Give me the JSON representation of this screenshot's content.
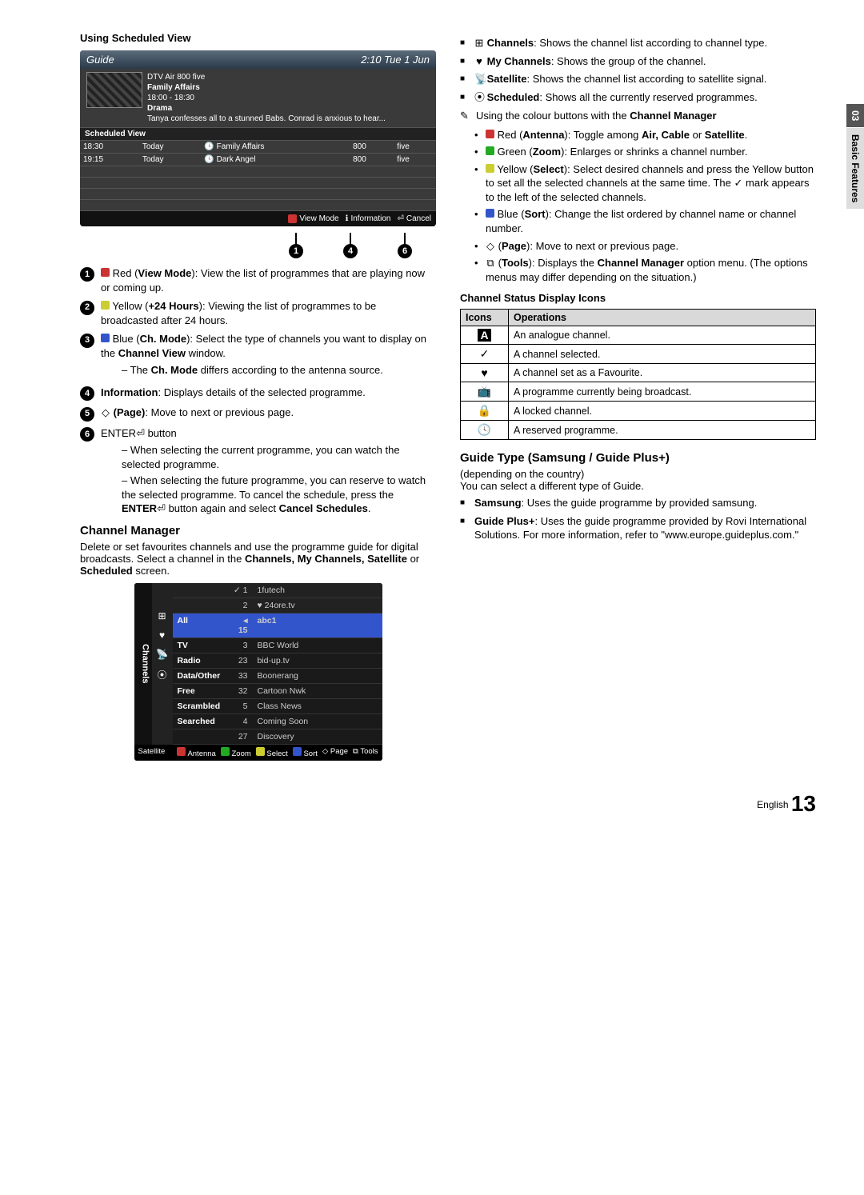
{
  "page_tab": {
    "num": "03",
    "label": "Basic Features"
  },
  "left": {
    "sched_head": "Using Scheduled View",
    "guide": {
      "title": "Guide",
      "clock": "2:10 Tue 1 Jun",
      "meta_source": "DTV Air 800 five",
      "meta_prog": "Family Affairs",
      "meta_time": "18:00 - 18:30",
      "meta_genre": "Drama",
      "meta_desc": "Tanya confesses all to a stunned Babs. Conrad is anxious to hear...",
      "sched_label": "Scheduled View",
      "rows": [
        {
          "time": "18:30",
          "day": "Today",
          "prog": "Family Affairs",
          "chno": "800",
          "chname": "five"
        },
        {
          "time": "19:15",
          "day": "Today",
          "prog": "Dark Angel",
          "chno": "800",
          "chname": "five"
        }
      ],
      "footer": {
        "a_label": "View Mode",
        "i_label": "Information",
        "cancel": "Cancel"
      }
    },
    "callouts": {
      "c1": "1",
      "c4": "4",
      "c6": "6"
    },
    "items": [
      {
        "n": "1",
        "chip": "red",
        "txt1": "Red (",
        "b1": "View Mode",
        "txt2": "): View the list of programmes that are playing now or coming up."
      },
      {
        "n": "2",
        "chip": "yellow",
        "txt1": "Yellow (",
        "b1": "+24 Hours",
        "txt2": "): Viewing the list of programmes to be broadcasted after 24 hours."
      },
      {
        "n": "3",
        "chip": "blue",
        "txt1": "Blue (",
        "b1": "Ch. Mode",
        "txt2": "): Select the type of channels you want to display on the ",
        "b2": "Channel View",
        "txt3": " window.",
        "sub": [
          "The Ch. Mode differs according to the antenna source."
        ],
        "sub_bold": "Ch. Mode"
      },
      {
        "n": "4",
        "b_lead": "Information",
        "txt": ": Displays details of the selected programme."
      },
      {
        "n": "5",
        "sym": "◇",
        "b_lead": "(Page)",
        "txt": ": Move to next or previous page."
      },
      {
        "n": "6",
        "txt_pre": "ENTER",
        "sym_enter": "⏎",
        "txt_post": " button",
        "subs": [
          "When selecting the current programme, you can watch the selected programme.",
          "When selecting the future programme, you can reserve to watch the selected programme. To cancel the schedule, press the ENTER⏎ button again and select Cancel Schedules."
        ],
        "sub_b1": "ENTER",
        "sub_b2": "Cancel Schedules"
      }
    ],
    "chmgr_h": "Channel Manager",
    "chmgr_p": "Delete or set favourites channels and use the programme guide for digital broadcasts. Select a channel in the ",
    "chmgr_b": "Channels, My Channels, Satellite",
    "chmgr_or": " or ",
    "chmgr_b2": "Scheduled",
    "chmgr_end": " screen.",
    "chbox": {
      "side": "Channels",
      "satellite": "Satellite",
      "top": [
        {
          "mark": "✓",
          "num": "1",
          "name": "1futech"
        },
        {
          "mark": "",
          "num": "2",
          "name": "24ore.tv",
          "heart": true
        }
      ],
      "all_row": {
        "label": "All",
        "num": "15",
        "name": "abc1"
      },
      "types": [
        "TV",
        "Radio",
        "Data/Other",
        "Free",
        "Scrambled",
        "Searched"
      ],
      "list": [
        {
          "num": "3",
          "name": "BBC World"
        },
        {
          "num": "23",
          "name": "bid-up.tv"
        },
        {
          "num": "33",
          "name": "Boonerang"
        },
        {
          "num": "32",
          "name": "Cartoon Nwk"
        },
        {
          "num": "5",
          "name": "Class News"
        },
        {
          "num": "4",
          "name": "Coming Soon"
        },
        {
          "num": "27",
          "name": "Discovery"
        }
      ],
      "footer": {
        "a": "Antenna",
        "b": "Zoom",
        "c": "Select",
        "d": "Sort",
        "page": "Page",
        "tools": "Tools"
      }
    }
  },
  "right": {
    "bullets": [
      {
        "icon": "⊞",
        "b": "Channels",
        "txt": ": Shows the channel list according to channel type."
      },
      {
        "icon": "♥",
        "b": "My Channels",
        "txt": ": Shows the group of the channel."
      },
      {
        "icon": "📡",
        "b": "Satellite",
        "txt": ": Shows the channel list according to satellite signal."
      },
      {
        "icon": "⦿",
        "b": "Scheduled",
        "txt": ": Shows all the currently reserved programmes."
      }
    ],
    "note_sym": "✎",
    "note_txt": "Using the colour buttons with the ",
    "note_b": "Channel Manager",
    "dots": [
      {
        "chip": "red",
        "txt1": "Red (",
        "b1": "Antenna",
        "txt2": "): Toggle among ",
        "b2": "Air, Cable",
        "txt3": " or ",
        "b3": "Satellite",
        "txt4": "."
      },
      {
        "chip": "green",
        "txt1": "Green (",
        "b1": "Zoom",
        "txt2": "): Enlarges or shrinks a channel number."
      },
      {
        "chip": "yellow",
        "txt1": "Yellow (",
        "b1": "Select",
        "txt2": "): Select desired channels and press the Yellow button to set all the selected channels at the same time. The ",
        "mark": "✓",
        "txt3": " mark appears to the left of the selected channels."
      },
      {
        "chip": "blue",
        "txt1": "Blue (",
        "b1": "Sort",
        "txt2": "): Change the list ordered by channel name or channel number."
      },
      {
        "sym": "◇",
        "txt1": "(",
        "b1": "Page",
        "txt2": "): Move to next or previous page."
      },
      {
        "sym": "⧉",
        "txt1": "(",
        "b1": "Tools",
        "txt2": "): Displays the ",
        "b2": "Channel Manager",
        "txt3": " option menu. (The options menus may differ depending on the situation.)"
      }
    ],
    "icons_head": "Channel Status Display Icons",
    "icons_th1": "Icons",
    "icons_th2": "Operations",
    "icons_rows": [
      {
        "ic": "A",
        "op": "An analogue channel."
      },
      {
        "ic": "✓",
        "op": "A channel selected."
      },
      {
        "ic": "♥",
        "op": "A channel set as a Favourite."
      },
      {
        "ic": "📺",
        "op": "A programme currently being broadcast."
      },
      {
        "ic": "🔒",
        "op": "A locked channel."
      },
      {
        "ic": "🕓",
        "op": "A reserved programme."
      }
    ],
    "gtype_h": "Guide Type (Samsung / Guide Plus+)",
    "gtype_dep": "(depending on the country)",
    "gtype_p": "You can select a different type of Guide.",
    "gtype_items": [
      {
        "b": "Samsung",
        "txt": ": Uses the guide programme by provided samsung."
      },
      {
        "b": "Guide Plus+",
        "txt": ": Uses the guide programme provided by Rovi International Solutions. For more information, refer to \"www.europe.guideplus.com.\""
      }
    ]
  },
  "footer": {
    "lang": "English",
    "page": "13"
  }
}
